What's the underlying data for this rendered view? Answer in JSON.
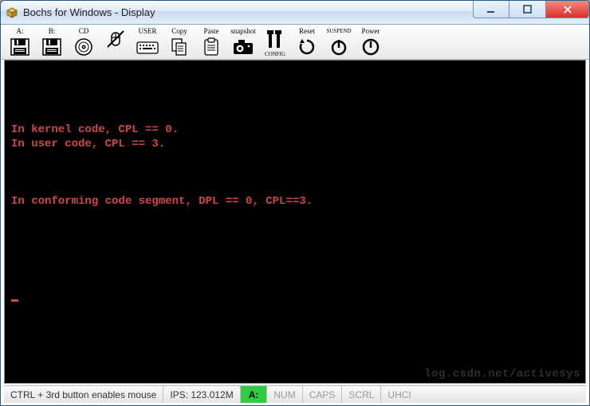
{
  "window": {
    "title": "Bochs for Windows - Display"
  },
  "toolbar": {
    "items": [
      {
        "label": "A:",
        "name": "floppy-a-button"
      },
      {
        "label": "B:",
        "name": "floppy-b-button"
      },
      {
        "label": "CD",
        "name": "cdrom-button"
      },
      {
        "label": "",
        "name": "mouse-capture-button"
      },
      {
        "label": "USER",
        "name": "user-button"
      },
      {
        "label": "Copy",
        "name": "copy-button"
      },
      {
        "label": "Paste",
        "name": "paste-button"
      },
      {
        "label": "snapshot",
        "name": "snapshot-button"
      },
      {
        "label": "CONFIG",
        "name": "config-button"
      },
      {
        "label": "Reset",
        "name": "reset-button"
      },
      {
        "label": "SUSPEND",
        "name": "suspend-button"
      },
      {
        "label": "Power",
        "name": "power-button"
      }
    ]
  },
  "terminal": {
    "lines": [
      "",
      "",
      "",
      "",
      "In kernel code, CPL == 0.",
      "In user code, CPL == 3.",
      "",
      "",
      "",
      "In conforming code segment, DPL == 0, CPL==3.",
      "",
      "",
      "",
      "",
      "",
      ""
    ],
    "watermark": "log.csdn.net/activesys"
  },
  "statusbar": {
    "hint": "CTRL + 3rd button enables mouse",
    "ips": "IPS: 123.012M",
    "drive": "A:",
    "indicators": [
      "NUM",
      "CAPS",
      "SCRL",
      "UHCI"
    ]
  }
}
